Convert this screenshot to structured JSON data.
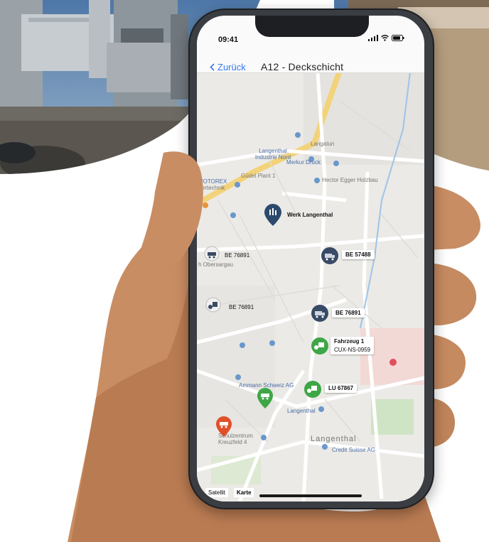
{
  "status_bar": {
    "time": "09:41",
    "signal_icon": "signal-bars-icon",
    "wifi_icon": "wifi-icon",
    "battery_icon": "battery-icon"
  },
  "nav": {
    "back_label": "Zurück",
    "back_icon": "chevron-left-icon",
    "title": "A12 - Deckschicht"
  },
  "map": {
    "places": {
      "langenthal_industrie_nord": "Langenthal Industrie Nord",
      "langatun": "Langatun",
      "merkur_druck": "Merkur Druck",
      "guedel_plant": "Güdel Plant 1",
      "hector_egger": "Hector Egger Holzbau",
      "motorex": "MOTOREX",
      "motorex_sub": "Fertechnik",
      "obersargau": "h Obersargau",
      "ammann": "Ammann Schweiz AG",
      "langenthal_station": "Langenthal",
      "langenthal_town": "Langenthal",
      "credit_suisse": "Credit Suisse AG",
      "schulfeld": "Schulzentrum Kreuzfeld 4"
    },
    "markers": [
      {
        "id": "werk",
        "label": "Werk Langenthal",
        "color": "#2c4a6b",
        "icon": "plant-icon"
      },
      {
        "id": "be57488",
        "label": "BE 57488",
        "color": "#394a66",
        "icon": "truck-icon"
      },
      {
        "id": "be76891a",
        "label": "BE 76891",
        "color": "#f0f0f0",
        "icon": "paver-icon"
      },
      {
        "id": "be76891b",
        "label": "BE 76891",
        "color": "#f0f0f0",
        "icon": "roller-icon"
      },
      {
        "id": "be76891c",
        "label": "BE 76891",
        "color": "#394a66",
        "icon": "truck-icon"
      },
      {
        "id": "fahrzeug1",
        "label": "Fahrzeug 1",
        "label2": "CUX-NS-0959",
        "color": "#3ea646",
        "icon": "roller-icon"
      },
      {
        "id": "lu67867",
        "label": "LU 67867",
        "color": "#3ea646",
        "icon": "roller-icon"
      },
      {
        "id": "green3",
        "label": "",
        "color": "#3ea646",
        "icon": "paver-icon"
      },
      {
        "id": "orange",
        "label": "",
        "color": "#e0502a",
        "icon": "paver-icon"
      }
    ],
    "toggle": {
      "satellit": "Satellit",
      "karte": "Karte"
    }
  }
}
